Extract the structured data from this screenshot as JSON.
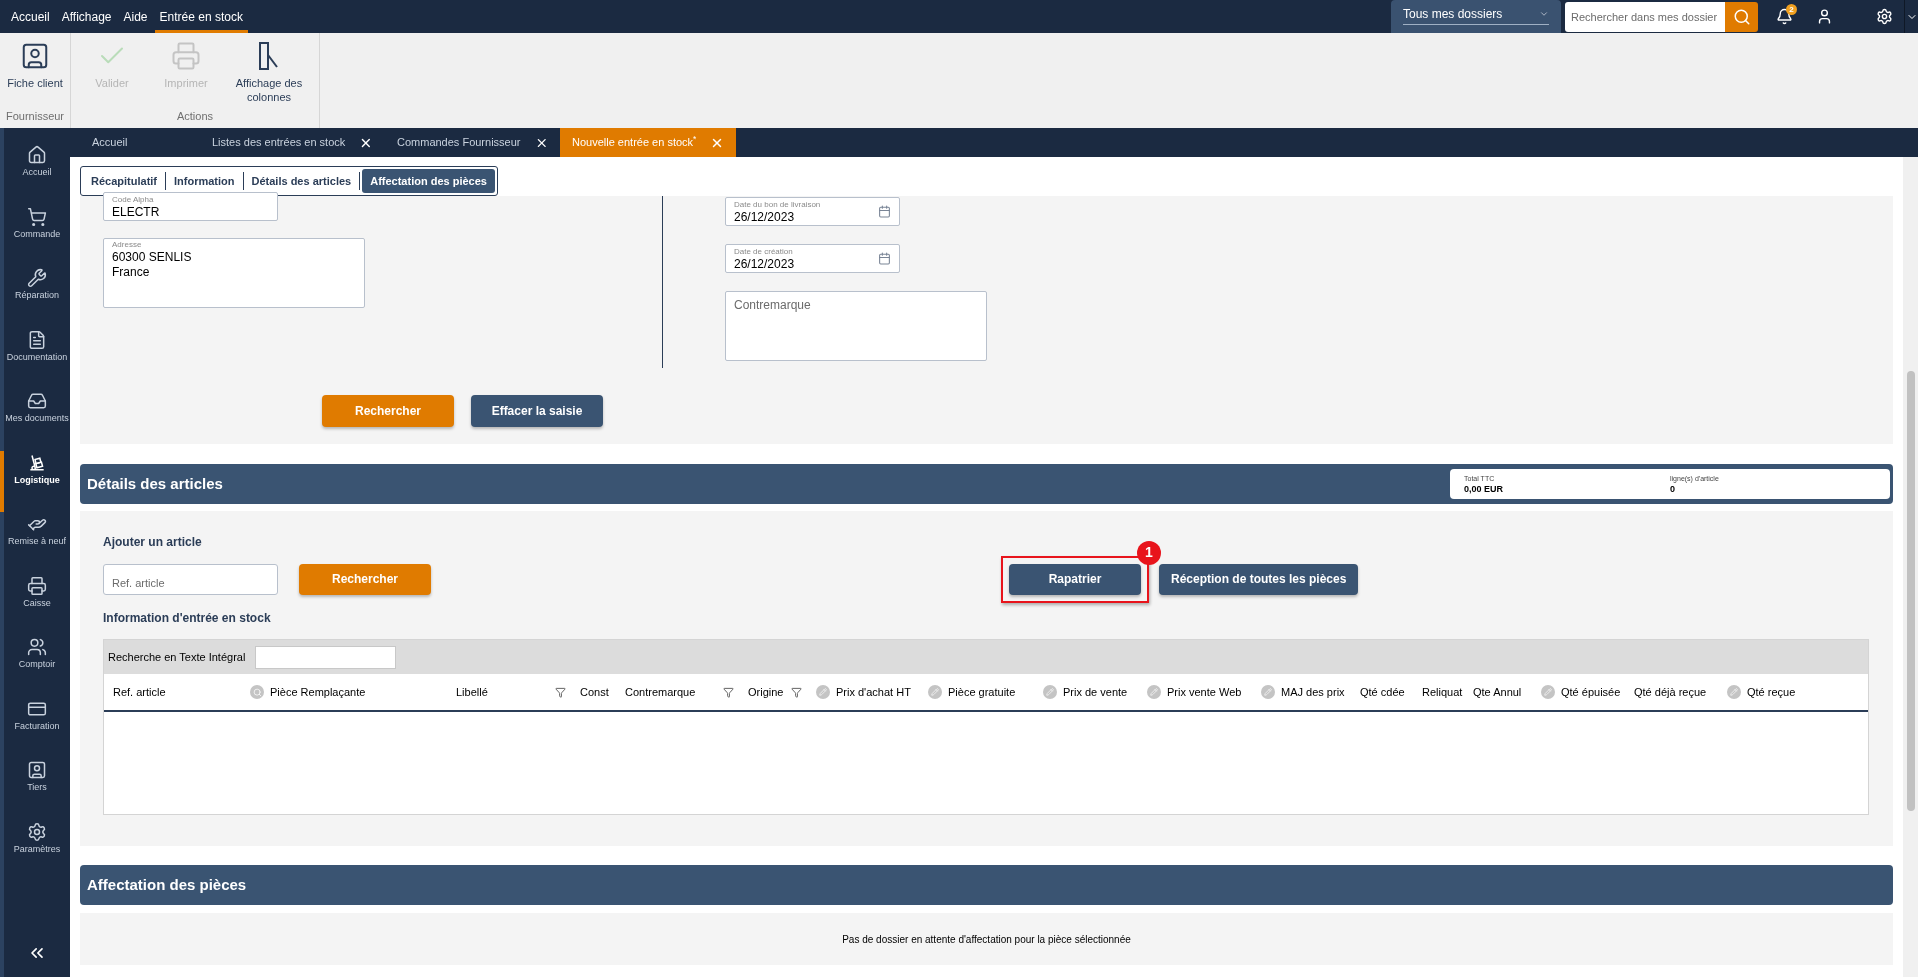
{
  "menu": [
    {
      "label": "Accueil",
      "selected": false
    },
    {
      "label": "Affichage",
      "selected": false
    },
    {
      "label": "Aide",
      "selected": false
    },
    {
      "label": "Entrée en stock",
      "selected": true
    }
  ],
  "folder_select": {
    "value": "Tous mes dossiers"
  },
  "search": {
    "placeholder": "Rechercher dans mes dossier"
  },
  "notifications": {
    "count": "2"
  },
  "ribbon": [
    {
      "group": "Fournisseur",
      "items": [
        {
          "kind": "client",
          "label": "Fiche client",
          "disabled": false
        }
      ]
    },
    {
      "group": "Actions",
      "items": [
        {
          "kind": "validate",
          "label": "Valider",
          "disabled": true
        },
        {
          "kind": "print",
          "label": "Imprimer",
          "disabled": true
        },
        {
          "kind": "columns",
          "label": "Affichage des colonnes",
          "disabled": false
        }
      ]
    }
  ],
  "sidebar": [
    {
      "kind": "home",
      "label": "Accueil",
      "selected": false
    },
    {
      "kind": "cart",
      "label": "Commande",
      "selected": false
    },
    {
      "kind": "wrench",
      "label": "Réparation",
      "selected": false
    },
    {
      "kind": "doc",
      "label": "Documentation",
      "selected": false
    },
    {
      "kind": "inbox",
      "label": "Mes documents",
      "selected": false
    },
    {
      "kind": "dolly",
      "label": "Logistique",
      "selected": true
    },
    {
      "kind": "hand",
      "label": "Remise à neuf",
      "selected": false
    },
    {
      "kind": "register",
      "label": "Caisse",
      "selected": false
    },
    {
      "kind": "people",
      "label": "Comptoir",
      "selected": false
    },
    {
      "kind": "card",
      "label": "Facturation",
      "selected": false
    },
    {
      "kind": "contact",
      "label": "Tiers",
      "selected": false
    },
    {
      "kind": "gear",
      "label": "Paramètres",
      "selected": false
    }
  ],
  "doc_tabs": [
    {
      "label": "Accueil",
      "closable": false,
      "selected": false
    },
    {
      "label": "Listes des entrées en stock",
      "closable": true,
      "selected": false
    },
    {
      "label": "Commandes Fournisseur",
      "closable": true,
      "selected": false
    },
    {
      "label": "Nouvelle entrée en stock$^{*}$",
      "closable": true,
      "selected": true
    }
  ],
  "sub_tabs": [
    {
      "label": "Récapitulatif",
      "selected": false
    },
    {
      "label": "Information",
      "selected": false
    },
    {
      "label": "Détails des articles",
      "selected": false
    },
    {
      "label": "Affectation des pièces",
      "selected": true
    }
  ],
  "form": {
    "left": [
      {
        "kind": "text",
        "label": "Code Alpha",
        "value": "ELECTR"
      },
      {
        "kind": "textarea",
        "label": "Adresse",
        "lines": [
          "60300 SENLIS",
          "France"
        ]
      }
    ],
    "right": [
      {
        "kind": "date",
        "label": "Date du bon de livraison",
        "value": "26/12/2023"
      },
      {
        "kind": "date",
        "label": "Date de création",
        "value": "26/12/2023"
      },
      {
        "kind": "textarea",
        "placeholder": "Contremarque"
      }
    ],
    "buttons": [
      {
        "label": "Rechercher",
        "kind": "primary"
      },
      {
        "label": "Effacer la saisie",
        "kind": "secondary"
      }
    ]
  },
  "details": {
    "title": "Détails des articles",
    "summary": [
      {
        "label": "Total TTC",
        "value": "0,00 EUR"
      },
      {
        "label": "ligne(s) d'article",
        "value": "0"
      }
    ],
    "add_title": "Ajouter un article",
    "ref_placeholder": "Ref. article",
    "search_button": "Rechercher",
    "actions": [
      {
        "label": "Rapatrier",
        "highlighted": true,
        "callout": "1"
      },
      {
        "label": "Réception de toutes les pièces",
        "highlighted": false
      }
    ],
    "info_title": "Information d'entrée en stock",
    "fulltext_label": "Recherche en Texte Intégral",
    "columns": [
      {
        "label": "Ref. article",
        "kind": "plain",
        "filter": false
      },
      {
        "label": "Pièce Remplaçante",
        "kind": "search",
        "filter": false
      },
      {
        "label": "Libellé",
        "kind": "plain",
        "filter": true
      },
      {
        "label": "Const",
        "kind": "plain",
        "filter": false
      },
      {
        "label": "Contremarque",
        "kind": "plain",
        "filter": true
      },
      {
        "label": "Origine",
        "kind": "plain",
        "filter": true
      },
      {
        "label": "Prix d'achat HT",
        "kind": "edit",
        "filter": false
      },
      {
        "label": "Pièce gratuite",
        "kind": "edit",
        "filter": false
      },
      {
        "label": "Prix de vente",
        "kind": "edit",
        "filter": false
      },
      {
        "label": "Prix vente Web",
        "kind": "edit",
        "filter": false
      },
      {
        "label": "MAJ des prix",
        "kind": "edit",
        "filter": false
      },
      {
        "label": "Qté cdée",
        "kind": "plain",
        "filter": false
      },
      {
        "label": "Reliquat",
        "kind": "plain",
        "filter": false
      },
      {
        "label": "Qte Annul",
        "kind": "plain",
        "filter": false
      },
      {
        "label": "Qté épuisée",
        "kind": "edit",
        "filter": false
      },
      {
        "label": "Qté déjà reçue",
        "kind": "plain",
        "filter": false
      },
      {
        "label": "Qté reçue",
        "kind": "edit",
        "filter": false
      }
    ]
  },
  "assignment": {
    "title": "Affectation des pièces",
    "message": "Pas de dossier en attente d'affectation pour la pièce sélectionnée"
  }
}
